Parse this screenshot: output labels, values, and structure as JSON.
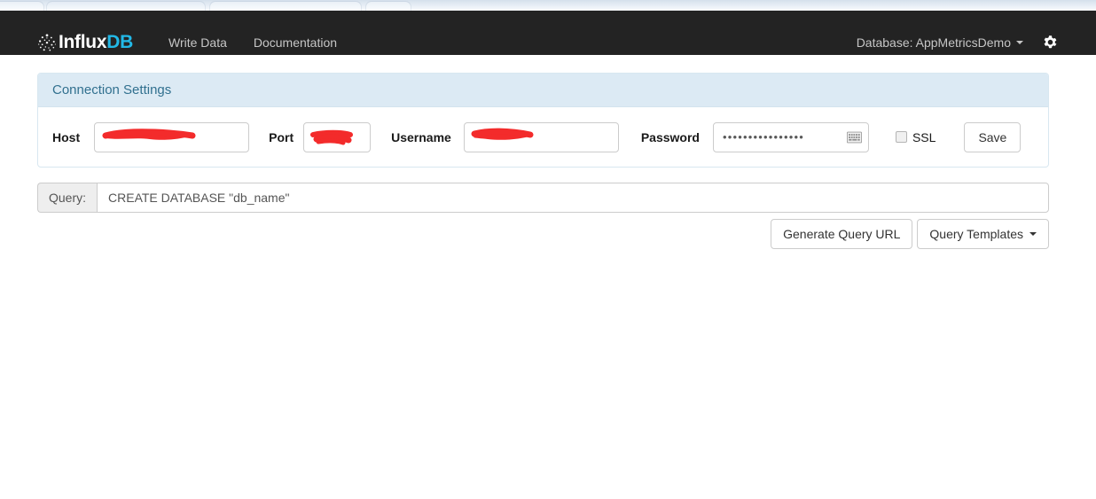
{
  "browser": {
    "tabs": [
      {
        "label": ""
      },
      {
        "label": ""
      },
      {
        "label": ""
      },
      {
        "label": ""
      }
    ]
  },
  "navbar": {
    "brand": {
      "text_primary": "Influx",
      "text_accent": "DB",
      "mark": "influxdb-logo-icon"
    },
    "links": [
      {
        "label": "Write Data",
        "name": "nav-link-write-data"
      },
      {
        "label": "Documentation",
        "name": "nav-link-documentation"
      }
    ],
    "database_selector": {
      "label": "Database: AppMetricsDemo",
      "value": "AppMetricsDemo",
      "prefix": "Database:"
    },
    "settings_icon": "gear-icon",
    "colors": {
      "background": "#232323",
      "link": "#c6c6c6",
      "accent": "#22b8e6"
    }
  },
  "connection_panel": {
    "title": "Connection Settings",
    "colors": {
      "heading_bg": "#dceaf4",
      "heading_text": "#31708f",
      "border": "#d8e7f0",
      "redaction": "#f32b2b"
    },
    "fields": [
      {
        "label": "Host",
        "value": "",
        "redacted": true,
        "placeholder": ""
      },
      {
        "label": "Port",
        "value": "",
        "redacted": true,
        "placeholder": ""
      },
      {
        "label": "Username",
        "value": "",
        "redacted": true,
        "placeholder": ""
      },
      {
        "label": "Password",
        "value": "••••••••••••••••",
        "redacted": false,
        "placeholder": ""
      }
    ],
    "ssl": {
      "label": "SSL",
      "checked": false
    },
    "save_button": {
      "label": "Save"
    },
    "password_icon": "onscreen-keyboard-icon"
  },
  "query_section": {
    "addon_label": "Query:",
    "input_value": "CREATE DATABASE \"db_name\"",
    "input_placeholder": "CREATE DATABASE \"db_name\"",
    "buttons": [
      {
        "label": "Generate Query URL",
        "name": "generate-query-url-button",
        "dropdown": false
      },
      {
        "label": "Query Templates",
        "name": "query-templates-button",
        "dropdown": true
      }
    ]
  }
}
